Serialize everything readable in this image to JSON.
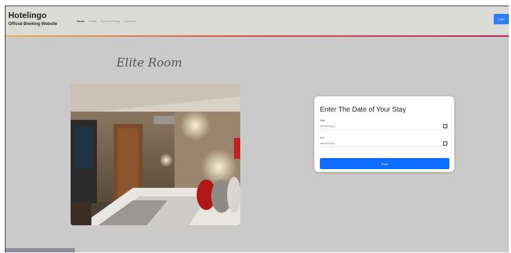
{
  "navbar": {
    "brand_title": "Hotelingo",
    "brand_subtitle": "Official Booking Website",
    "links": [
      {
        "label": "Home",
        "active": true
      },
      {
        "label": "Profile",
        "active": false
      },
      {
        "label": "Room & Pricing",
        "active": false
      },
      {
        "label": "Service ▾",
        "active": false
      }
    ],
    "login_label": "Login"
  },
  "room": {
    "title": "Elite Room"
  },
  "booking": {
    "title": "Enter The Date of Your Stay",
    "start_label": "Start",
    "start_value": "dd/mm/yyyy",
    "end_label": "End",
    "end_value": "dd/mm/yyyy",
    "button_label": "Book"
  },
  "colors": {
    "navbar_bg": "#dcdcd7",
    "page_bg": "#cacaca",
    "primary": "#0d6efd"
  },
  "icons": {
    "start_picker": "calendar-icon",
    "end_picker": "calendar-icon"
  }
}
